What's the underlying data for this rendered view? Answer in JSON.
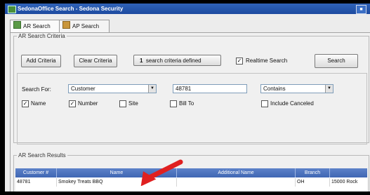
{
  "window": {
    "title": "SedonaOffice Search - Sedona Security"
  },
  "tabs": [
    {
      "label": "AR Search"
    },
    {
      "label": "AP Search"
    }
  ],
  "criteria": {
    "group_label": "AR Search Criteria",
    "add_label": "Add Criteria",
    "clear_label": "Clear Criteria",
    "count": "1",
    "count_text": "search criteria defined",
    "realtime_label": "Realtime Search",
    "realtime_checked": true,
    "search_label": "Search",
    "search_for_label": "Search For:",
    "search_for_value": "Customer",
    "search_text": "48781",
    "match_value": "Contains",
    "fields": [
      {
        "label": "Name",
        "checked": true
      },
      {
        "label": "Number",
        "checked": true
      },
      {
        "label": "Site",
        "checked": false
      },
      {
        "label": "Bill To",
        "checked": false
      }
    ],
    "include_canceled_label": "Include Canceled",
    "include_canceled_checked": false
  },
  "results": {
    "group_label": "AR Search Results",
    "columns": [
      "Customer #",
      "Name",
      "Additional Name",
      "Branch",
      ""
    ],
    "rows": [
      {
        "customer": "48781",
        "name": "Smokey Treats BBQ",
        "additional": "",
        "branch": "OH",
        "extra": "15000 Rock"
      }
    ]
  },
  "colors": {
    "titlebar": "#1d4aa0",
    "grid_header": "#4a70bd",
    "annotation_arrow": "#e02020"
  }
}
